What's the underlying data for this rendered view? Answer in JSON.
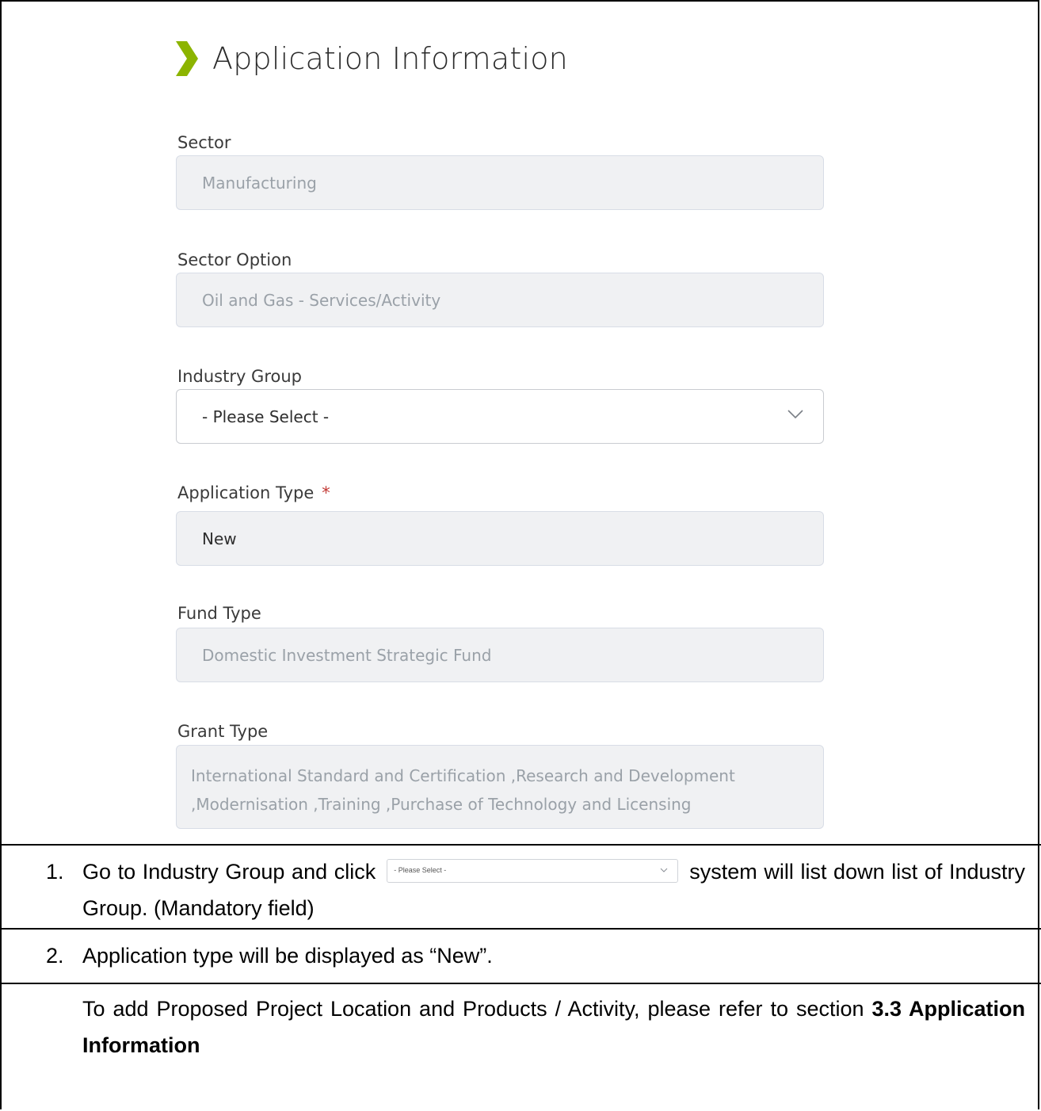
{
  "form": {
    "title": "Application Information",
    "fields": [
      {
        "label": "Sector",
        "value": ""
      },
      {
        "label": "Sector Option",
        "value": ""
      },
      {
        "label": "Industry Group",
        "value": ""
      },
      {
        "label": "Application Type",
        "required_mark": "*",
        "value": "New"
      },
      {
        "label": "Fund Type",
        "value": ""
      },
      {
        "label": "Grant Type",
        "value_line1": "International Standard and Certification ,Research and Development",
        "value_line2": ",Modernisation ,Training ,Purchase of Technology and Licensing"
      }
    ],
    "sector_value": "Manufacturing",
    "sector_option_value": "Oil and Gas - Services/Activity",
    "industry_group_placeholder": "- Please Select -",
    "fund_type_value": "Domestic Investment Strategic Fund"
  },
  "instructions": {
    "step1_number": "1.",
    "step1_before": "Go to Industry Group and click",
    "step1_inline_select": "- Please Select -",
    "step1_after": "system will list down list of Industry Group. (Mandatory field)",
    "step2_number": "2.",
    "step2_text": "Application type will be displayed as “New”.",
    "note_text": "To add Proposed Project Location and Products / Activity, please refer to section",
    "note_bold": "3.3 Application Information"
  },
  "colors": {
    "chevron_accent": "#8cb400",
    "required_star": "#c23934",
    "disabled_field_bg": "#f0f1f3"
  }
}
